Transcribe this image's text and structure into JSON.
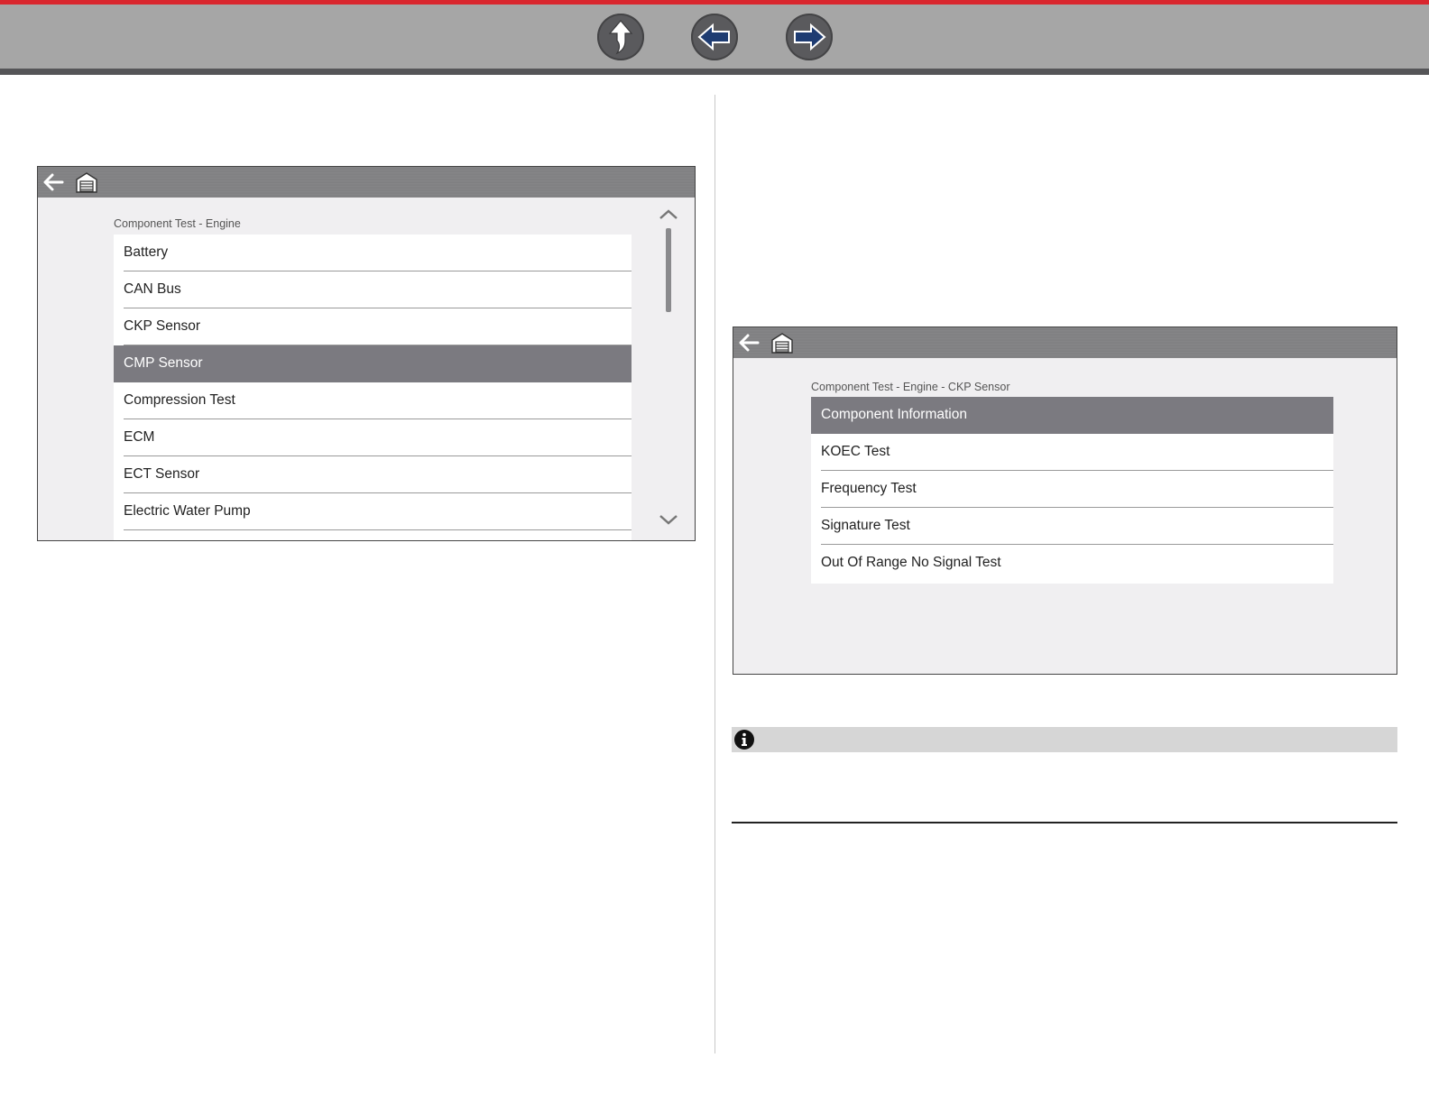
{
  "toolbar": {
    "buttons": [
      {
        "icon": "up-arrow-icon"
      },
      {
        "icon": "left-arrow-icon"
      },
      {
        "icon": "right-arrow-icon"
      }
    ],
    "accent_color": "#d9262e"
  },
  "screen_left": {
    "header_icons": [
      "back-arrow-icon",
      "home-icon"
    ],
    "breadcrumb": "Component Test - Engine",
    "items": [
      {
        "label": "Battery",
        "selected": false
      },
      {
        "label": "CAN Bus",
        "selected": false
      },
      {
        "label": "CKP Sensor",
        "selected": false
      },
      {
        "label": "CMP Sensor",
        "selected": true
      },
      {
        "label": "Compression Test",
        "selected": false
      },
      {
        "label": "ECM",
        "selected": false
      },
      {
        "label": "ECT Sensor",
        "selected": false
      },
      {
        "label": "Electric Water Pump",
        "selected": false
      }
    ],
    "scroll_icons": [
      "chevron-up-icon",
      "chevron-down-icon"
    ]
  },
  "screen_right": {
    "header_icons": [
      "back-arrow-icon",
      "home-icon"
    ],
    "breadcrumb": "Component Test - Engine - CKP Sensor",
    "items": [
      {
        "label": "Component Information",
        "selected": true
      },
      {
        "label": "KOEC Test",
        "selected": false
      },
      {
        "label": "Frequency Test",
        "selected": false
      },
      {
        "label": "Signature Test",
        "selected": false
      },
      {
        "label": "Out Of Range No Signal Test",
        "selected": false
      }
    ]
  },
  "note": {
    "icon": "info-icon"
  }
}
